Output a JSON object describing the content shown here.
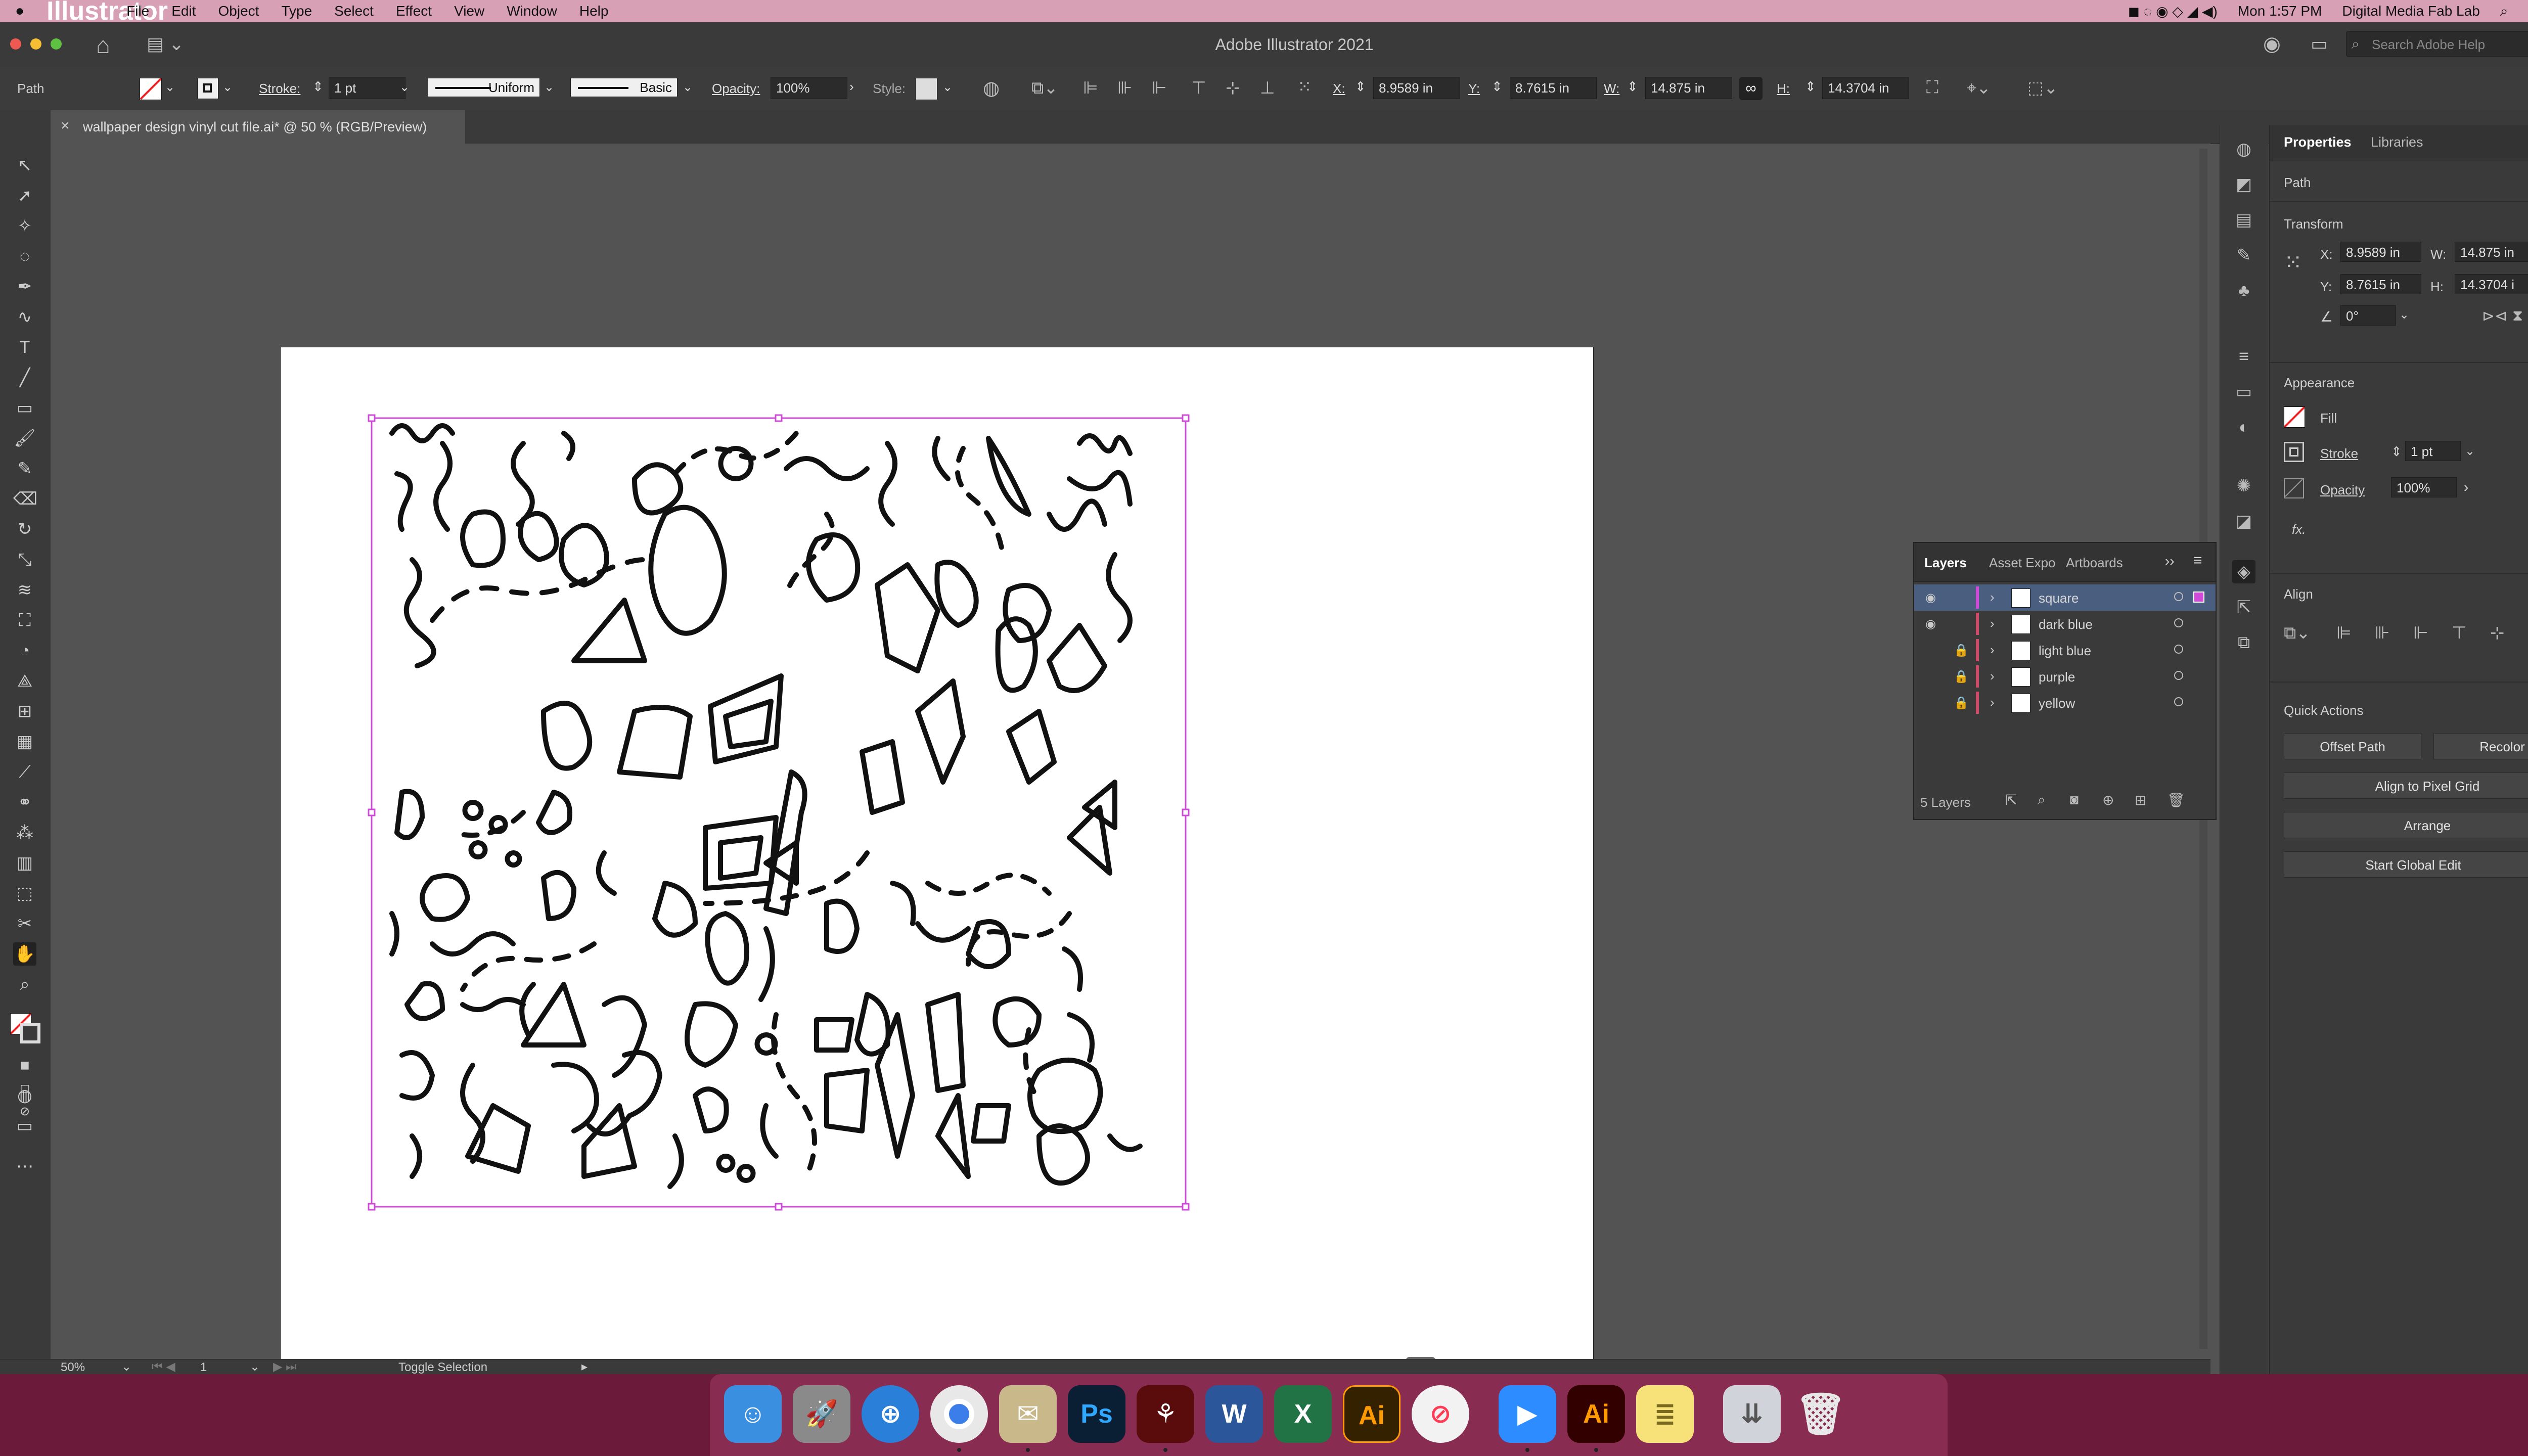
{
  "menubar": {
    "apple": "",
    "app_name": "Illustrator",
    "items": [
      "File",
      "Edit",
      "Object",
      "Type",
      "Select",
      "Effect",
      "View",
      "Window",
      "Help"
    ],
    "clock": "Mon 1:57 PM",
    "user": "Digital Media Fab Lab"
  },
  "window": {
    "title": "Adobe Illustrator 2021",
    "search_placeholder": "Search Adobe Help"
  },
  "control_bar": {
    "selection_type": "Path",
    "stroke_label": "Stroke:",
    "stroke_value": "1 pt",
    "profile_uniform": "Uniform",
    "brush_basic": "Basic",
    "opacity_label": "Opacity:",
    "opacity_value": "100%",
    "style_label": "Style:",
    "x_label": "X:",
    "x_value": "8.9589 in",
    "y_label": "Y:",
    "y_value": "8.7615 in",
    "w_label": "W:",
    "w_value": "14.875 in",
    "h_label": "H:",
    "h_value": "14.3704 in"
  },
  "document_tab": {
    "close": "×",
    "title": "wallpaper design vinyl cut file.ai* @ 50 % (RGB/Preview)"
  },
  "properties": {
    "tab_properties": "Properties",
    "tab_libraries": "Libraries",
    "selection": "Path",
    "transform_title": "Transform",
    "x_label": "X:",
    "x_value": "8.9589 in",
    "y_label": "Y:",
    "y_value": "8.7615 in",
    "w_label": "W:",
    "w_value": "14.875 in",
    "h_label": "H:",
    "h_value": "14.3704 i",
    "angle_value": "0°",
    "appearance_title": "Appearance",
    "fill_label": "Fill",
    "stroke_label": "Stroke",
    "stroke_value": "1 pt",
    "opacity_label": "Opacity",
    "opacity_value": "100%",
    "fx_label": "fx.",
    "align_title": "Align",
    "quick_actions_title": "Quick Actions",
    "btn_offset_path": "Offset Path",
    "btn_recolor": "Recolor",
    "btn_align_pixel": "Align to Pixel Grid",
    "btn_arrange": "Arrange",
    "btn_global_edit": "Start Global Edit"
  },
  "layers_panel": {
    "tab_layers": "Layers",
    "tab_asset": "Asset Expo",
    "tab_artboards": "Artboards",
    "footer": "5 Layers",
    "layers": [
      {
        "name": "square",
        "color": "#d04ad8",
        "visible": true,
        "locked": false,
        "selected": true
      },
      {
        "name": "dark blue",
        "color": "#d04a6a",
        "visible": true,
        "locked": false,
        "selected": false
      },
      {
        "name": "light blue",
        "color": "#d04a6a",
        "visible": false,
        "locked": true,
        "selected": false
      },
      {
        "name": "purple",
        "color": "#d04a6a",
        "visible": false,
        "locked": true,
        "selected": false
      },
      {
        "name": "yellow",
        "color": "#d04a6a",
        "visible": false,
        "locked": true,
        "selected": false
      }
    ]
  },
  "status_bar": {
    "zoom": "50%",
    "artboard_num": "1",
    "tool_status": "Toggle Selection"
  },
  "dock_apps": [
    "Finder",
    "Launchpad",
    "Safari",
    "Chrome",
    "Preview",
    "Photoshop",
    "Acrobat",
    "Word",
    "Excel",
    "Illustrator",
    "News",
    "Zoom",
    "Illustrator",
    "Notes",
    "Downloads",
    "Trash"
  ],
  "colors": {
    "menubar": "#d8a0b4",
    "selection_bounds": "#d04ad8",
    "ui_dark": "#3a3a3a",
    "canvas": "#535353"
  }
}
